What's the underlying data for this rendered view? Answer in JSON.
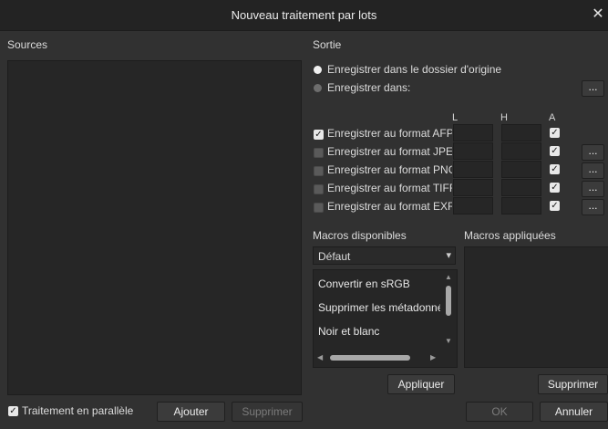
{
  "window": {
    "title": "Nouveau traitement par lots",
    "close_glyph": "✕"
  },
  "sources": {
    "label": "Sources"
  },
  "output": {
    "label": "Sortie",
    "radio_origin": "Enregistrer dans le dossier d'origine",
    "radio_custom": "Enregistrer dans:",
    "browse_glyph": "...",
    "columns": {
      "l": "L",
      "h": "H",
      "a": "A"
    },
    "formats": [
      {
        "label": "Enregistrer au format AFPhoto",
        "checked": true,
        "a_checked": true,
        "has_options": false
      },
      {
        "label": "Enregistrer au format JPEG",
        "checked": false,
        "a_checked": true,
        "has_options": true
      },
      {
        "label": "Enregistrer au format PNG",
        "checked": false,
        "a_checked": true,
        "has_options": true
      },
      {
        "label": "Enregistrer au format TIFF",
        "checked": false,
        "a_checked": true,
        "has_options": true
      },
      {
        "label": "Enregistrer au format EXR",
        "checked": false,
        "a_checked": true,
        "has_options": true
      }
    ],
    "options_glyph": "..."
  },
  "macros": {
    "available_label": "Macros disponibles",
    "applied_label": "Macros appliquées",
    "category_selected": "Défaut",
    "items": [
      "Convertir en sRGB",
      "Supprimer les métadonnées",
      "Noir et blanc"
    ],
    "apply_button": "Appliquer",
    "remove_button": "Supprimer"
  },
  "footer": {
    "parallel_label": "Traitement en parallèle",
    "parallel_checked": true,
    "add_button": "Ajouter",
    "remove_button": "Supprimer",
    "ok_button": "OK",
    "cancel_button": "Annuler"
  },
  "check_glyph": "✓",
  "dropdown_arrow": "▾",
  "scroll_up": "▲",
  "scroll_down": "▼",
  "scroll_left": "◀",
  "scroll_right": "▶"
}
